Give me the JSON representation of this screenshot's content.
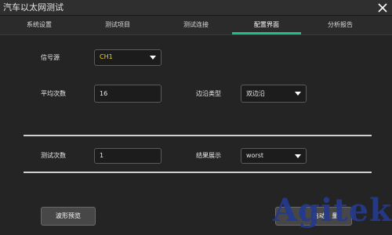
{
  "window": {
    "title": "汽车以太网测试"
  },
  "tabs": [
    {
      "label": "系统设置",
      "active": false
    },
    {
      "label": "测试项目",
      "active": false
    },
    {
      "label": "测试连接",
      "active": false
    },
    {
      "label": "配置界面",
      "active": true
    },
    {
      "label": "分析报告",
      "active": false
    }
  ],
  "form": {
    "signal_source": {
      "label": "信号源",
      "value": "CH1",
      "value_color": "#f2d700"
    },
    "average_count": {
      "label": "平均次数",
      "value": "16"
    },
    "edge_type": {
      "label": "边沿类型",
      "value": "双边沿"
    },
    "test_count": {
      "label": "测试次数",
      "value": "1"
    },
    "result_display": {
      "label": "结果展示",
      "value": "worst"
    }
  },
  "buttons": {
    "waveform_preview": "波形预览",
    "start_measure_partial_1": "启动",
    "start_measure_partial_2": "量"
  },
  "watermark": {
    "text_main": "Agitek"
  },
  "colors": {
    "accent": "#19c08a",
    "background": "#242424"
  }
}
